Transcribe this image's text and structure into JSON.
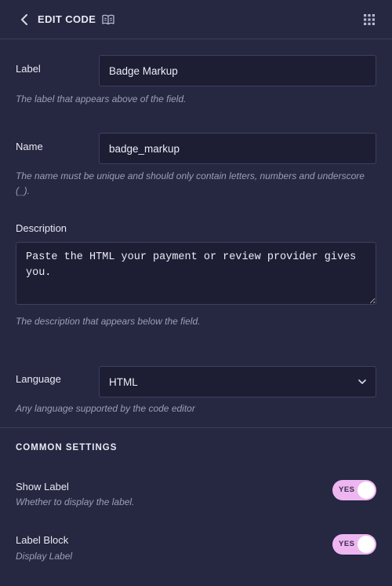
{
  "header": {
    "title": "EDIT CODE"
  },
  "fields": {
    "label": {
      "label": "Label",
      "value": "Badge Markup",
      "help": "The label that appears above of the field."
    },
    "name": {
      "label": "Name",
      "value": "badge_markup",
      "help": "The name must be unique and should only contain letters, numbers and underscore (_)."
    },
    "description": {
      "label": "Description",
      "value": "Paste the HTML your payment or review provider gives you.",
      "help": "The description that appears below the field."
    },
    "language": {
      "label": "Language",
      "value": "HTML",
      "help": "Any language supported by the code editor"
    }
  },
  "common_settings": {
    "heading": "COMMON SETTINGS",
    "show_label": {
      "label": "Show Label",
      "help": "Whether to display the label.",
      "toggle_text": "YES",
      "on": true
    },
    "label_block": {
      "label": "Label Block",
      "help": "Display Label",
      "toggle_text": "YES",
      "on": true
    }
  },
  "colors": {
    "background": "#262741",
    "input_bg": "#1d1e34",
    "toggle_on": "#eeb6f0"
  },
  "icons": {
    "back": "chevron-left-icon",
    "docs": "book-icon",
    "menu": "grid-icon",
    "select": "chevron-down-icon"
  }
}
